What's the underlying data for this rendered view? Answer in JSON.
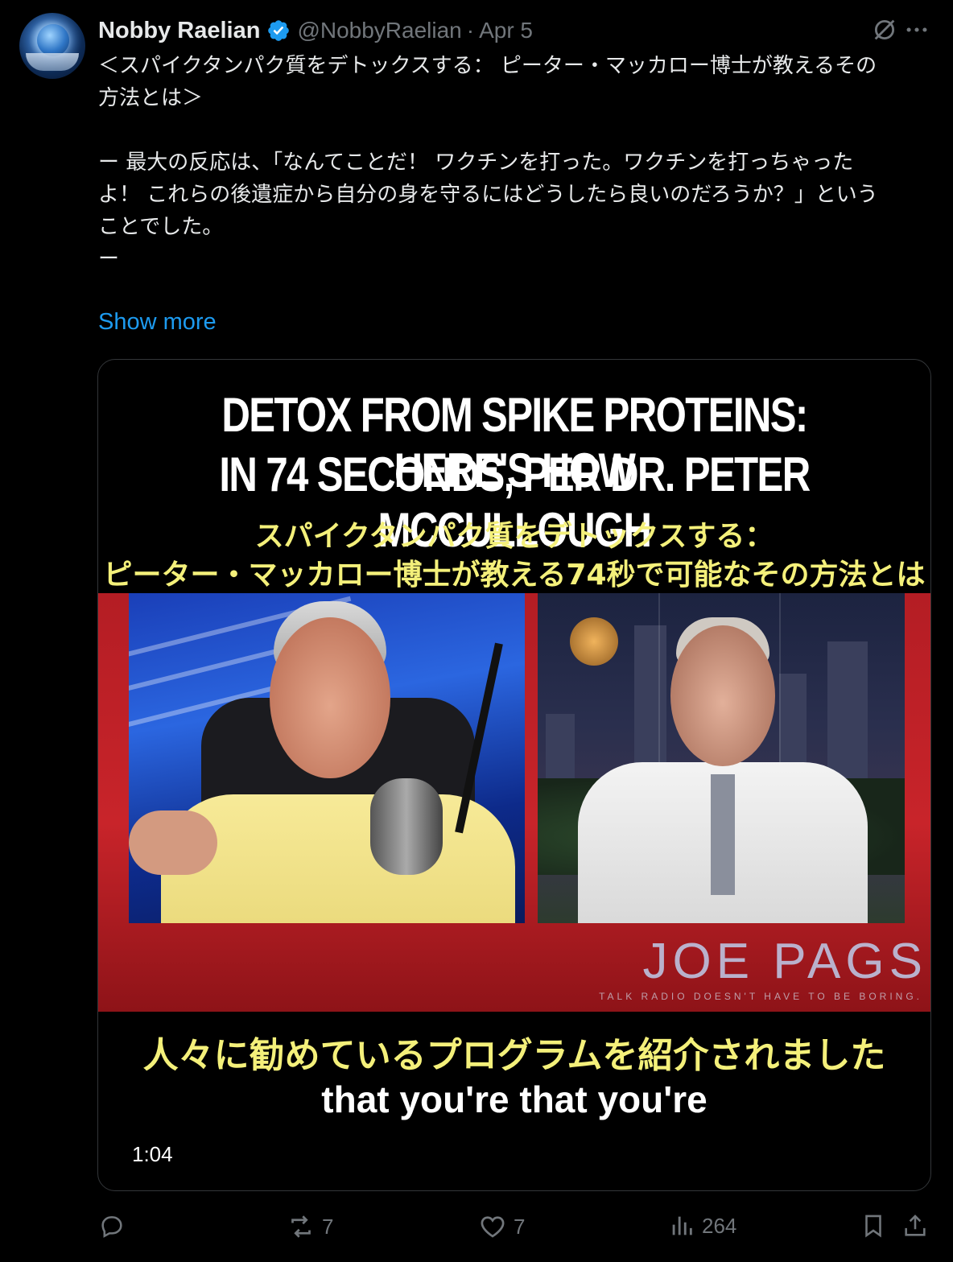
{
  "author": {
    "name": "Nobby Raelian",
    "handle": "@NobbyRaelian",
    "separator": "·",
    "date": "Apr 5"
  },
  "post": {
    "line1": "＜スパイクタンパク質をデトックスする： ピーター・マッカロー博士が教えるその",
    "line2": "方法とは＞",
    "line3": "ー 最大の反応は、「なんてことだ！ ワクチンを打った。ワクチンを打っちゃった",
    "line4": "よ！ これらの後遺症から自分の身を守るにはどうしたら良いのだろうか？」という",
    "line5": "ことでした。",
    "line6": "ー",
    "show_more": "Show more"
  },
  "video": {
    "title1": "DETOX FROM SPIKE PROTEINS: HERE'S HOW",
    "title2": "IN 74 SECONDS, PER DR. PETER MCCULLOUGH",
    "jp_title1": "スパイクタンパク質をデトックスする：",
    "jp_title2": "ピーター・マッカロー博士が教える74秒で可能なその方法とは",
    "brand": "JOE PAGS",
    "brand_tagline": "TALK RADIO DOESN'T HAVE TO BE BORING.",
    "subtitle_jp": "人々に勧めているプログラムを紹介されました",
    "subtitle_en": "that you're that you're",
    "duration": "1:04"
  },
  "actions": {
    "reply_count": "",
    "repost_count": "7",
    "like_count": "7",
    "views_count": "264"
  },
  "colors": {
    "accent": "#1d9bf0",
    "muted": "#71767b",
    "subtitle_yellow": "#f4f07a"
  }
}
